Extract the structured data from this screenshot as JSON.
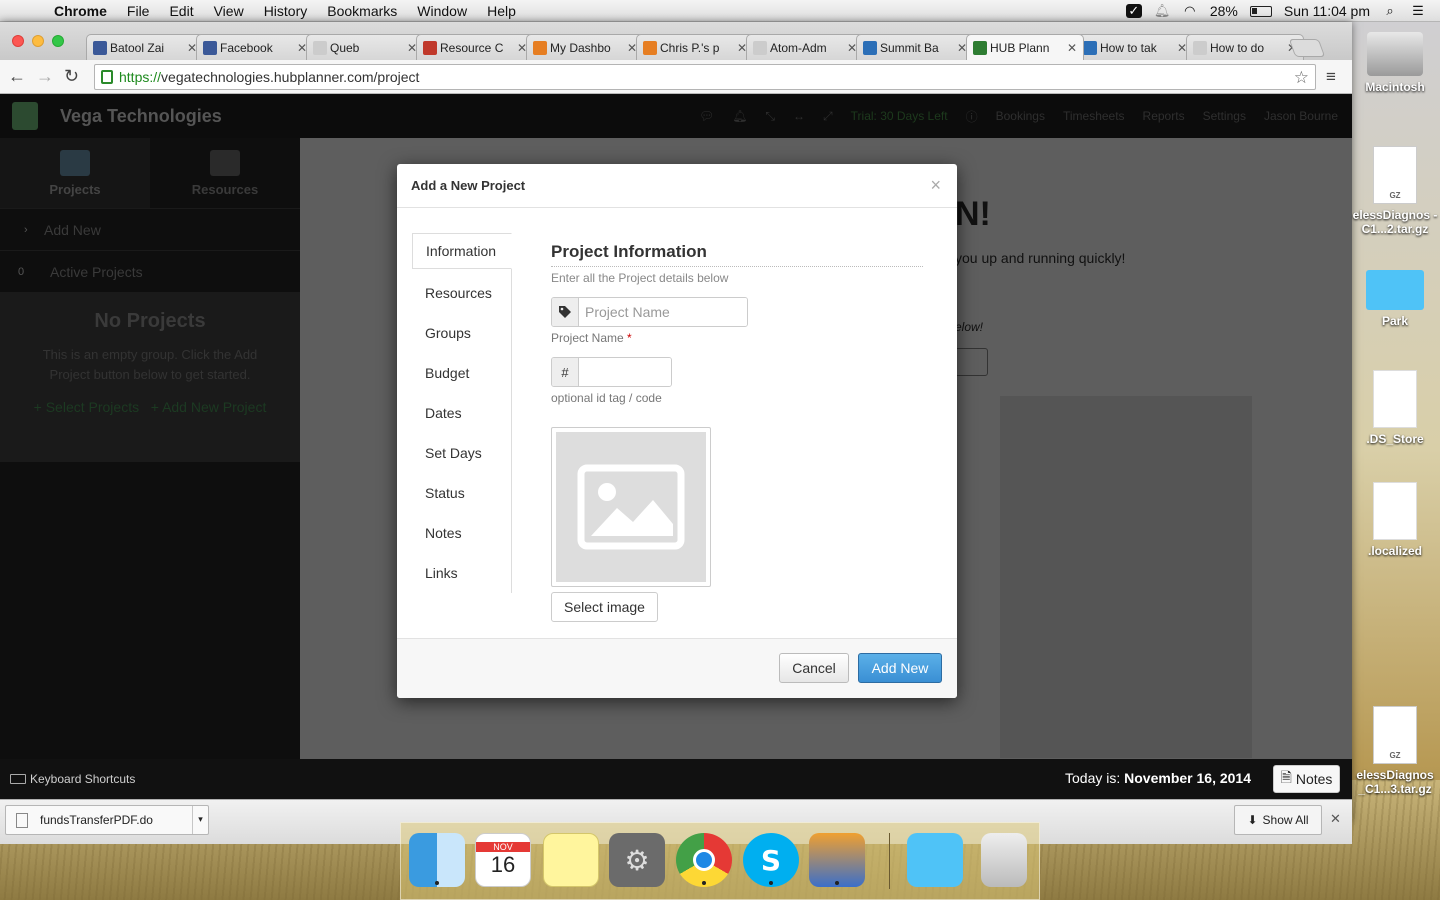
{
  "menubar": {
    "app_name": "Chrome",
    "items": [
      "File",
      "Edit",
      "View",
      "History",
      "Bookmarks",
      "Window",
      "Help"
    ],
    "battery": "28%",
    "clock": "Sun 11:04 pm"
  },
  "browser": {
    "tabs": [
      {
        "label": "Batool Zai",
        "favicon": "facebook-icon",
        "color": "#3b5998"
      },
      {
        "label": "Facebook",
        "favicon": "facebook-icon",
        "color": "#3b5998"
      },
      {
        "label": "Queb",
        "favicon": "page-icon",
        "color": "#cccccc"
      },
      {
        "label": "Resource C",
        "favicon": "resource-icon",
        "color": "#c0392b"
      },
      {
        "label": "My Dashbo",
        "favicon": "dashboard-icon",
        "color": "#e67e22"
      },
      {
        "label": "Chris P.'s p",
        "favicon": "dashboard-icon",
        "color": "#e67e22"
      },
      {
        "label": "Atom-Adm",
        "favicon": "page-icon",
        "color": "#cccccc"
      },
      {
        "label": "Summit Ba",
        "favicon": "summit-icon",
        "color": "#2c6fb7"
      },
      {
        "label": "HUB Plann",
        "favicon": "hubplanner-icon",
        "color": "#2e7d32",
        "active": true
      },
      {
        "label": "How to tak",
        "favicon": "howto-icon",
        "color": "#2c6fb7"
      },
      {
        "label": "How to do",
        "favicon": "page-icon",
        "color": "#cccccc"
      }
    ],
    "url_scheme": "https://",
    "url_rest": "vegatechnologies.hubplanner.com/project"
  },
  "app": {
    "brand": "Vega Technologies",
    "nav": [
      "Trial: 30 Days Left",
      "Bookings",
      "Timesheets",
      "Reports",
      "Settings",
      "Jason Bourne"
    ],
    "sidebar": {
      "tabs": [
        "Projects",
        "Resources"
      ],
      "add_new": "Add New",
      "active_count": "0",
      "active_label": "Active Projects",
      "empty_title": "No Projects",
      "empty_text": "This is an empty group. Click the Add Project button below to get started.",
      "select_projects": "Select Projects",
      "add_new_project": "Add New Project"
    },
    "bg_heading": "N!",
    "bg_line1": "you up and running quickly!",
    "bg_line2": "elow!",
    "footer": {
      "keyboard_shortcuts": "Keyboard Shortcuts",
      "today_label": "Today is:",
      "today_date": "November 16, 2014",
      "notes": "Notes"
    }
  },
  "modal": {
    "title": "Add a New Project",
    "close": "×",
    "tabs": [
      "Information",
      "Resources",
      "Groups",
      "Budget",
      "Dates",
      "Set Days",
      "Status",
      "Notes",
      "Links"
    ],
    "section_title": "Project Information",
    "section_sub": "Enter all the Project details below",
    "project_name_placeholder": "Project Name",
    "project_name_help": "Project Name",
    "required_mark": "*",
    "code_addon": "#",
    "code_help": "optional id tag / code",
    "select_image": "Select image",
    "cancel": "Cancel",
    "add_new": "Add New"
  },
  "downloads": {
    "file": "fundsTransferPDF.do",
    "show_all": "Show All"
  },
  "desktop": {
    "icons": [
      "Macintosh",
      "elessDiagnos -C1...2.tar.gz",
      "Park",
      ".DS_Store",
      ".localized",
      "elessDiagnos _C1...3.tar.gz"
    ]
  },
  "dock": {
    "calendar_month": "NOV",
    "calendar_day": "16"
  }
}
